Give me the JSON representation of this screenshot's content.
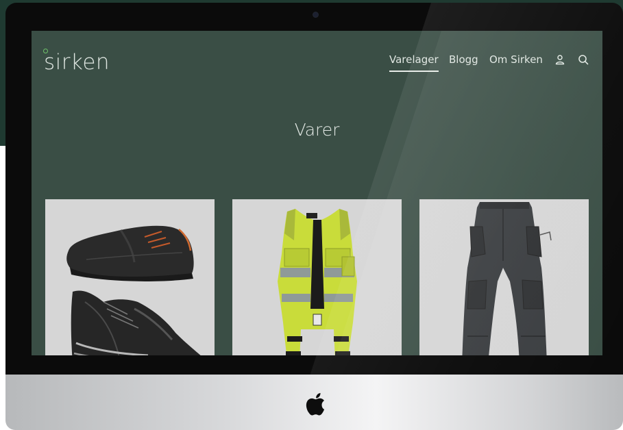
{
  "site": {
    "logo": "sirken",
    "nav": [
      {
        "label": "Varelager",
        "active": true
      },
      {
        "label": "Blogg",
        "active": false
      },
      {
        "label": "Om Sirken",
        "active": false
      }
    ],
    "icons": [
      "account-icon",
      "search-icon"
    ],
    "page_title": "Varer",
    "products": [
      {
        "image": "safety-shoes"
      },
      {
        "image": "hi-vis-vest"
      },
      {
        "image": "work-trousers"
      }
    ]
  },
  "colors": {
    "page_bg": "#3a4e45",
    "backdrop": "#1f3a31",
    "accent_green": "#6fc36b",
    "text": "#dfe6e1",
    "card_bg": "#d6d6d6"
  }
}
